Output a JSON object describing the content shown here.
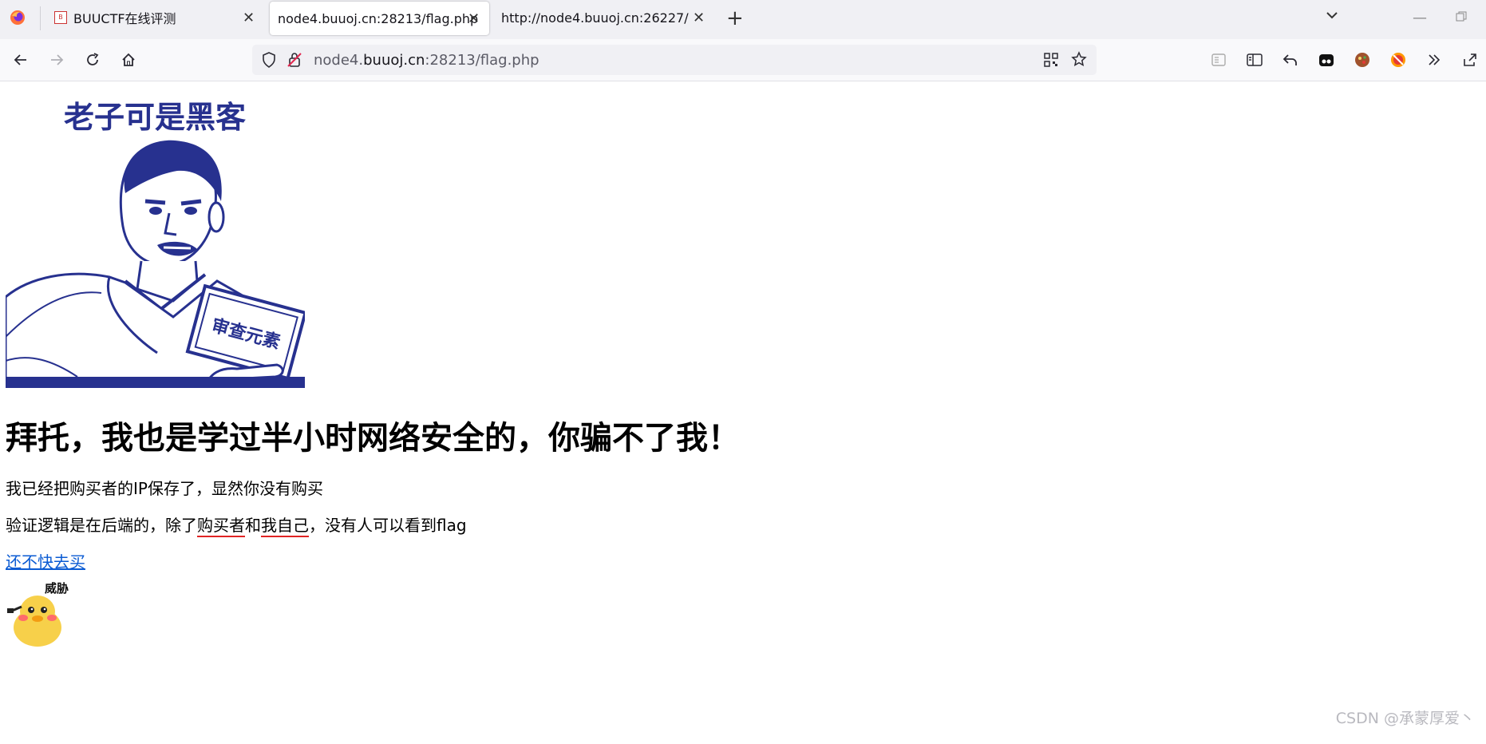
{
  "tabs": [
    {
      "label": "BUUCTF在线评测",
      "active": false
    },
    {
      "label": "node4.buuoj.cn:28213/flag.php",
      "active": true
    },
    {
      "label": "http://node4.buuoj.cn:26227/",
      "active": false
    }
  ],
  "address": {
    "prefix": "node4.",
    "host": "buuoj.cn",
    "rest": ":28213/flag.php"
  },
  "page": {
    "meme_caption": "老子可是黑客",
    "meme_book_text": "审查元素",
    "heading": "拜托，我也是学过半小时网络安全的，你骗不了我！",
    "para1": "我已经把购买者的IP保存了，显然你没有购买",
    "para2_start": "验证逻辑是在后端的，除了",
    "para2_buyer": "购买者",
    "para2_and": "和",
    "para2_me": "我自己",
    "para2_end": "，没有人可以看到flag",
    "link": "还不快去买",
    "duck_caption": "威胁"
  },
  "watermark": "CSDN @承蒙厚爱丶",
  "icons": [
    "firefox-icon",
    "buuctf-favicon",
    "close-icon",
    "plus-icon",
    "chevron-down-icon",
    "minimize-icon",
    "restore-icon",
    "back-icon",
    "forward-icon",
    "reload-icon",
    "home-icon",
    "shield-icon",
    "lock-insecure-icon",
    "qr-code-icon",
    "star-icon",
    "reader-icon",
    "sidebar-icon",
    "undo-icon",
    "extension-icon",
    "overflow-icon",
    "share-icon"
  ],
  "colors": {
    "link": "#0b5bd3",
    "meme_blue": "#27318f",
    "red_underline": "#e02424"
  }
}
